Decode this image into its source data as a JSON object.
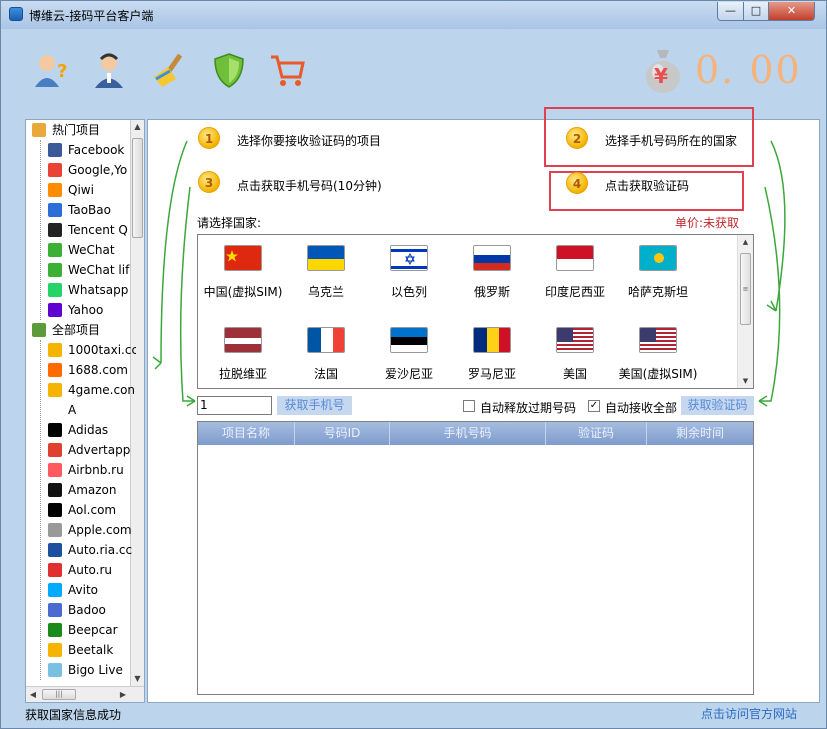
{
  "window": {
    "title": "博维云-接码平台客户端",
    "min_glyph": "—",
    "max_glyph": "□",
    "close_glyph": "✕"
  },
  "toolbar": {
    "icons": [
      "user-help-icon",
      "user-agent-icon",
      "broom-icon",
      "shield-icon",
      "cart-icon"
    ],
    "currency_symbol": "¥",
    "balance": "0. 00"
  },
  "sidebar": {
    "items": [
      {
        "label": "热门项目",
        "icon": "folder-hot-icon",
        "color": "#e8a93a",
        "level": 0
      },
      {
        "label": "Facebook",
        "icon": "facebook-icon",
        "color": "#3b5998",
        "level": 1
      },
      {
        "label": "Google,Yo",
        "icon": "google-icon",
        "color": "#ea4335",
        "level": 1
      },
      {
        "label": "Qiwi",
        "icon": "qiwi-icon",
        "color": "#ff8c00",
        "level": 1
      },
      {
        "label": "TaoBao",
        "icon": "taobao-icon",
        "color": "#2b6ed8",
        "level": 1
      },
      {
        "label": "Tencent Q",
        "icon": "tencent-qq-icon",
        "color": "#222222",
        "level": 1
      },
      {
        "label": "WeChat",
        "icon": "wechat-icon",
        "color": "#3cb034",
        "level": 1
      },
      {
        "label": "WeChat lif",
        "icon": "wechat-life-icon",
        "color": "#3cb034",
        "level": 1
      },
      {
        "label": "Whatsapp",
        "icon": "whatsapp-icon",
        "color": "#25d366",
        "level": 1
      },
      {
        "label": "Yahoo",
        "icon": "yahoo-icon",
        "color": "#5f01d1",
        "level": 1
      },
      {
        "label": "全部项目",
        "icon": "folder-all-icon",
        "color": "#5b9b3a",
        "level": 0
      },
      {
        "label": "1000taxi.cc",
        "icon": "taxi-icon",
        "color": "#f5b400",
        "level": 1
      },
      {
        "label": "1688.com",
        "icon": "1688-icon",
        "color": "#ff6a00",
        "level": 1
      },
      {
        "label": "4game.con",
        "icon": "4game-icon",
        "color": "#f5b400",
        "level": 1
      },
      {
        "label": "A",
        "icon": "",
        "color": "#ffffff",
        "level": 1
      },
      {
        "label": "Adidas",
        "icon": "adidas-icon",
        "color": "#000000",
        "level": 1
      },
      {
        "label": "Advertapp",
        "icon": "advertapp-icon",
        "color": "#e04030",
        "level": 1
      },
      {
        "label": "Airbnb.ru",
        "icon": "airbnb-icon",
        "color": "#ff5a5f",
        "level": 1
      },
      {
        "label": "Amazon",
        "icon": "amazon-icon",
        "color": "#111111",
        "level": 1
      },
      {
        "label": "Aol.com",
        "icon": "aol-icon",
        "color": "#000000",
        "level": 1
      },
      {
        "label": "Apple.com",
        "icon": "apple-icon",
        "color": "#999999",
        "level": 1
      },
      {
        "label": "Auto.ria.cc",
        "icon": "autoria-icon",
        "color": "#1d4fa0",
        "level": 1
      },
      {
        "label": "Auto.ru",
        "icon": "autoru-icon",
        "color": "#e03030",
        "level": 1
      },
      {
        "label": "Avito",
        "icon": "avito-icon",
        "color": "#00aaff",
        "level": 1
      },
      {
        "label": "Badoo",
        "icon": "badoo-icon",
        "color": "#4a6ad0",
        "level": 1
      },
      {
        "label": "Beepcar",
        "icon": "beepcar-icon",
        "color": "#1a8a1a",
        "level": 1
      },
      {
        "label": "Beetalk",
        "icon": "beetalk-icon",
        "color": "#f5b400",
        "level": 1
      },
      {
        "label": "Bigo Live",
        "icon": "bigo-live-icon",
        "color": "#7ac0e0",
        "level": 1
      }
    ]
  },
  "steps": [
    {
      "num": "1",
      "text": "选择你要接收验证码的项目"
    },
    {
      "num": "2",
      "text": "选择手机号码所在的国家"
    },
    {
      "num": "3",
      "text": "点击获取手机号码(10分钟)"
    },
    {
      "num": "4",
      "text": "点击获取验证码"
    }
  ],
  "country_section": {
    "label": "请选择国家:",
    "price_label": "单价:",
    "price_value": "未获取"
  },
  "countries": [
    {
      "name": "中国(虚拟SIM)",
      "flag": "china-flag-icon"
    },
    {
      "name": "乌克兰",
      "flag": "ukraine-flag-icon"
    },
    {
      "name": "以色列",
      "flag": "israel-flag-icon"
    },
    {
      "name": "俄罗斯",
      "flag": "russia-flag-icon"
    },
    {
      "name": "印度尼西亚",
      "flag": "indonesia-flag-icon"
    },
    {
      "name": "哈萨克斯坦",
      "flag": "kazakhstan-flag-icon"
    },
    {
      "name": "拉脱维亚",
      "flag": "latvia-flag-icon"
    },
    {
      "name": "法国",
      "flag": "france-flag-icon"
    },
    {
      "name": "爱沙尼亚",
      "flag": "estonia-flag-icon"
    },
    {
      "name": "罗马尼亚",
      "flag": "romania-flag-icon"
    },
    {
      "name": "美国",
      "flag": "usa-flag-icon"
    },
    {
      "name": "美国(虚拟SIM)",
      "flag": "usa-flag-icon"
    }
  ],
  "controls": {
    "quantity_value": "1",
    "get_number_button": "获取手机号",
    "auto_release_label": "自动释放过期号码",
    "auto_release_checked": false,
    "auto_receive_label": "自动接收全部",
    "auto_receive_checked": true,
    "get_code_button": "获取验证码"
  },
  "table": {
    "columns": [
      "项目名称",
      "号码ID",
      "手机号码",
      "验证码",
      "剩余时间"
    ],
    "rows": []
  },
  "statusbar": {
    "status_text": "获取国家信息成功",
    "official_link": "点击访问官方网站"
  }
}
